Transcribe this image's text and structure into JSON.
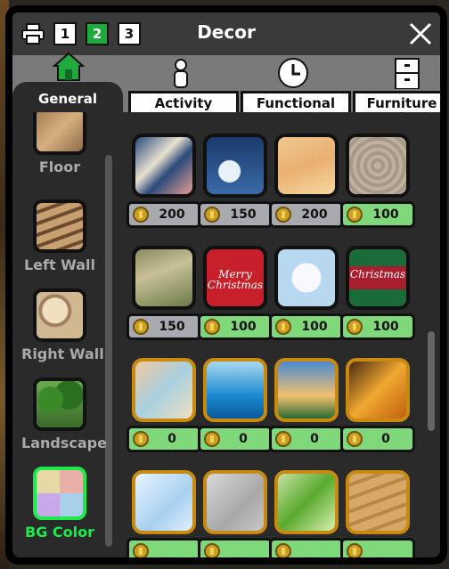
{
  "window": {
    "title": "Decor"
  },
  "pages": [
    "1",
    "2",
    "3"
  ],
  "active_page": "2",
  "tabs": [
    {
      "label": "General",
      "icon": "house-icon",
      "active": true
    },
    {
      "label": "Activity",
      "icon": "person-icon"
    },
    {
      "label": "Functional",
      "icon": "clock-icon"
    },
    {
      "label": "Furniture",
      "icon": "cabinet-icon"
    }
  ],
  "sidebar": [
    {
      "label": "Floor",
      "icon": "floor-icon"
    },
    {
      "label": "Left Wall",
      "icon": "left-wall-icon"
    },
    {
      "label": "Right Wall",
      "icon": "right-wall-icon"
    },
    {
      "label": "Landscape",
      "icon": "landscape-icon"
    },
    {
      "label": "BG Color",
      "icon": "bg-color-icon",
      "selected": true
    }
  ],
  "items": [
    {
      "price": "200",
      "style": "grey"
    },
    {
      "price": "150",
      "style": "grey"
    },
    {
      "price": "200",
      "style": "grey"
    },
    {
      "price": "100",
      "style": "green"
    },
    {
      "price": "150",
      "style": "grey"
    },
    {
      "price": "100",
      "style": "green",
      "text": "Merry Christmas"
    },
    {
      "price": "100",
      "style": "green"
    },
    {
      "price": "100",
      "style": "green",
      "text": "Christmas"
    },
    {
      "price": "0",
      "style": "green"
    },
    {
      "price": "0",
      "style": "green"
    },
    {
      "price": "0",
      "style": "green"
    },
    {
      "price": "0",
      "style": "green"
    },
    {
      "price": "",
      "style": "green"
    },
    {
      "price": "",
      "style": "green"
    },
    {
      "price": "",
      "style": "green"
    },
    {
      "price": "",
      "style": "green"
    }
  ],
  "colors": {
    "accent": "#1eaa3c",
    "price_green": "#7fd87a",
    "price_grey": "#a8aab0",
    "panel": "#2a2a2a"
  }
}
